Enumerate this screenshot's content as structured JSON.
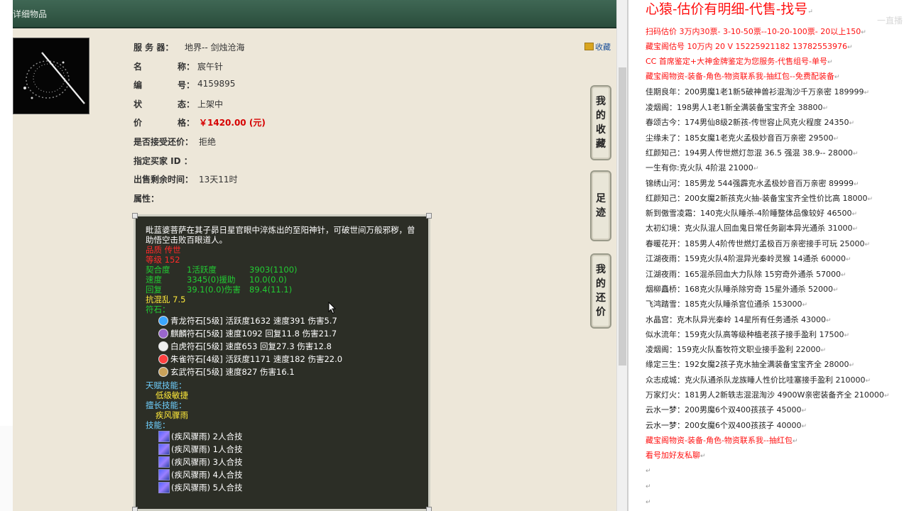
{
  "left_page": {
    "title_bar_text": "详细物品",
    "collect_link": "收藏",
    "fields": {
      "server_label": "服 务 器：",
      "server_value": "地界-- 剑烛沧海",
      "name_label_1": "名",
      "name_label_2": "称：",
      "name_value": "宸午针",
      "id_label_1": "编",
      "id_label_2": "号：",
      "id_value": "4159895",
      "status_label_1": "状",
      "status_label_2": "态：",
      "status_value": "上架中",
      "price_label_1": "价",
      "price_label_2": "格：",
      "price_value": "￥1420.00 (元)",
      "counteroffer_label": "是否接受还价：",
      "counteroffer_value": "拒绝",
      "buyer_label": "指定买家 ID ：",
      "time_label": "出售剩余时间：",
      "time_value": "13天11时",
      "attr_label": "属性："
    },
    "detail": {
      "description": "毗蓝婆菩萨在其子昴日星官眼中淬炼出的至阳神针，可破世间万般邪秽，曾助悟空击败百眼道人。",
      "quality": "品质   传世",
      "level": "等级   152",
      "stats": [
        [
          "契合度",
          "1活跃度",
          "3903(1100)"
        ],
        [
          "速度",
          "3345(0)援助",
          "10.0(0.0)"
        ],
        [
          "回复",
          "39.1(0.0)伤害",
          "89.4(11.1)"
        ]
      ],
      "anti": "抗混乱 7.5",
      "rune_header": "符石：",
      "runes": [
        {
          "text": "青龙符石[5级] 活跃度1632 速度391 伤害5.7",
          "color": "#3aa6ff",
          "icon": "azure-dragon-rune-icon"
        },
        {
          "text": "麒麟符石[5级] 速度1092 回复11.8 伤害21.7",
          "color": "#9966cc",
          "icon": "qilin-rune-icon"
        },
        {
          "text": "白虎符石[5级] 速度653 回复27.3 伤害12.8",
          "color": "#f0f0f0",
          "icon": "white-tiger-rune-icon"
        },
        {
          "text": "朱雀符石[4级] 活跃度1171 速度182 伤害22.0",
          "color": "#ff4040",
          "icon": "vermilion-bird-rune-icon"
        },
        {
          "text": "玄武符石[5级] 速度827 伤害16.1",
          "color": "#c9a25a",
          "icon": "black-tortoise-rune-icon"
        }
      ],
      "talent_header": "天赋技能：",
      "talent_value": "低级敏捷",
      "specialty_header": "擅长技能：",
      "specialty_value": "疾风骤雨",
      "skills_header": "技能：",
      "skills": [
        "(疾风骤雨) 2人合技",
        "(疾风骤雨) 1人合技",
        "(疾风骤雨) 3人合技",
        "(疾风骤雨) 4人合技",
        "(疾风骤雨) 5人合技"
      ]
    },
    "tabs": {
      "favorites": [
        "我",
        "的",
        "收",
        "藏"
      ],
      "footprint": [
        "足",
        "迹"
      ],
      "counteroffers": [
        "我",
        "的",
        "还",
        "价"
      ]
    }
  },
  "notepad": {
    "watermark": "一直播",
    "lines": [
      {
        "text": "心猿-估价有明细-代售-找号",
        "style": "red big"
      },
      {
        "text": "扫码估价 3万内30票- 3-10-50票--10-20-100票- 20以上150",
        "style": "red"
      },
      {
        "text": "藏宝阁估号 10万内 20 V 15225921182   13782553976",
        "style": "red"
      },
      {
        "text": "CC 首席鉴定+大神金牌鉴定为您服务-代售组号-单号",
        "style": "red"
      },
      {
        "text": "藏宝阁物资-装备-角色-物资联系我-抽红包--免费配装备",
        "style": "red"
      },
      {
        "text": "佳期良年：200男魔1老1新5破神兽衫混淘沙千万亲密 189999",
        "style": ""
      },
      {
        "text": "凌烟阁：198男人1老1新全满装备宝宝齐全 38800",
        "style": ""
      },
      {
        "text": "春颂古今：174男仙8级2新孩-传世容止风克火程度 24350",
        "style": ""
      },
      {
        "text": "尘缘未了：185女魔1老克火孟极妙音百万亲密 29500",
        "style": ""
      },
      {
        "text": "红颜知己：194男人传世燃灯忽混 36.5 强混 38.9-- 28000",
        "style": ""
      },
      {
        "text": "一生有你:克火队 4阶混 21000",
        "style": ""
      },
      {
        "text": "锦绣山河：185男龙 544强霹克水孟极妙音百万亲密 89999",
        "style": ""
      },
      {
        "text": "红颜知己：200女魔2新孩克火抽-装备宝宝齐全性价比高 18000",
        "style": ""
      },
      {
        "text": "新到傲雪凌霜：140克火队睡杀-4阶睡整体品像较好 46500",
        "style": ""
      },
      {
        "text": "太初幻境：克火队混人回血鬼日常任务副本异光通杀 31000",
        "style": ""
      },
      {
        "text": "春暖花开：185男人4阶传世燃灯孟极百万亲密接手可玩 25000",
        "style": ""
      },
      {
        "text": "江湖夜雨：159克火队4阶混异光秦岭灵猴 14通杀 60000",
        "style": ""
      },
      {
        "text": "江湖夜雨：165混杀回血大力队除 15穷奇外通杀 57000",
        "style": ""
      },
      {
        "text": "烟柳矗桥：168克火队睡杀除穷奇 15星外通杀 52000",
        "style": ""
      },
      {
        "text": "飞鸿踏雪：185克火队睡杀宫位通杀 153000",
        "style": ""
      },
      {
        "text": "水晶宫：克木队异光秦岭 14星所有任务通杀 43000",
        "style": ""
      },
      {
        "text": "似水流年：159克火队高等级种植老孩子接手盈利 17500",
        "style": ""
      },
      {
        "text": "凌烟阁：159克火队畜牧符文职业接手盈利 22000",
        "style": ""
      },
      {
        "text": "缘定三生：192女魔2孩子克水抽全满装备宝宝齐全 28000",
        "style": ""
      },
      {
        "text": "众志成城：克火队通杀队龙族睡人性价比哇塞接手盈利 210000",
        "style": ""
      },
      {
        "text": "万家灯火：181男人2新轶志混混淘沙 4900W亲密装备齐全 210000",
        "style": ""
      },
      {
        "text": "云水一梦：200男魔6个双400孩孩子 45000",
        "style": ""
      },
      {
        "text": "云水一梦：200女魔6个双400孩孩子 40000",
        "style": ""
      },
      {
        "text": "藏宝阁物资-装备-角色-物资联系我--抽红包",
        "style": "red"
      },
      {
        "text": "看号加好友私聊",
        "style": "red"
      },
      {
        "text": "",
        "style": ""
      },
      {
        "text": "",
        "style": ""
      },
      {
        "text": "",
        "style": ""
      }
    ]
  },
  "colors": {
    "title_bar": "#2f5644",
    "page_bg": "#ede7d9",
    "price_red": "#d60000",
    "panel_bg": "#2c2e26",
    "notepad_red": "#ff1010"
  }
}
